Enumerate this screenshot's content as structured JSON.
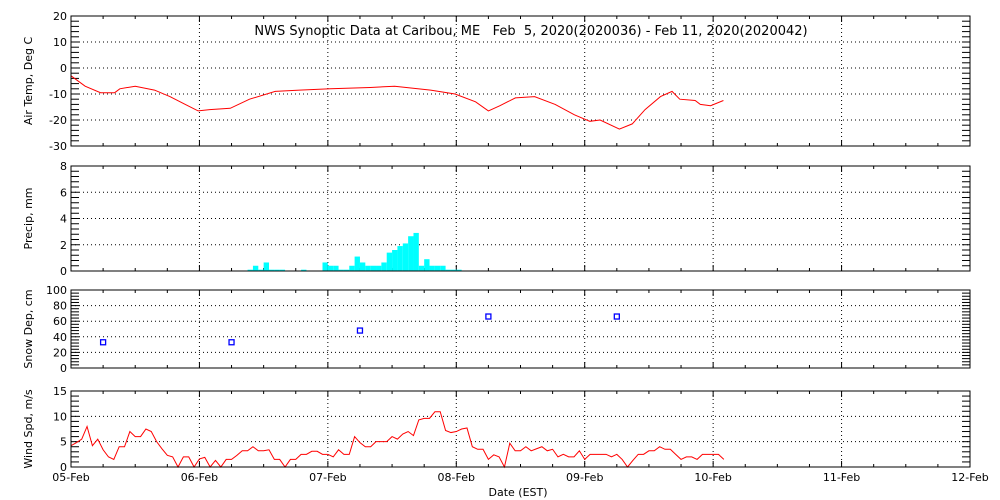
{
  "chart_data": {
    "type": "line",
    "title": "NWS Synoptic Data at Caribou, ME   Feb  5, 2020(2020036) - Feb 11, 2020(2020042)",
    "xlabel": "Date (EST)",
    "x_ticks": [
      "05-Feb",
      "06-Feb",
      "07-Feb",
      "08-Feb",
      "09-Feb",
      "10-Feb",
      "11-Feb",
      "12-Feb"
    ],
    "x_range_days": [
      0,
      7
    ],
    "grid": true,
    "panels": [
      {
        "name": "air-temp",
        "type": "line",
        "ylabel": "Air Temp, Deg C",
        "ylim": [
          -30,
          20
        ],
        "yticks": [
          -30,
          -20,
          -10,
          0,
          10,
          20
        ],
        "color": "#ff0000",
        "x_days": [
          0,
          0.11,
          0.23,
          0.34,
          0.38,
          0.5,
          0.65,
          0.77,
          0.89,
          0.99,
          1.08,
          1.24,
          1.39,
          1.59,
          1.78,
          2.02,
          2.33,
          2.52,
          2.8,
          2.99,
          3.15,
          3.25,
          3.34,
          3.46,
          3.61,
          3.77,
          3.92,
          4.04,
          4.12,
          4.27,
          4.37,
          4.47,
          4.59,
          4.68,
          4.74,
          4.86,
          4.9,
          4.98,
          5.08
        ],
        "values": [
          -3,
          -7,
          -9.5,
          -9.5,
          -8,
          -7,
          -8.5,
          -11,
          -14,
          -16.5,
          -16,
          -15.5,
          -12,
          -9,
          -8.5,
          -8,
          -7.5,
          -7,
          -8.5,
          -10,
          -13,
          -16.5,
          -14.5,
          -11.5,
          -11,
          -14,
          -18,
          -20.5,
          -20,
          -23.5,
          -21.5,
          -16,
          -11,
          -9,
          -12,
          -12.5,
          -14,
          -14.5,
          -12.5
        ]
      },
      {
        "name": "precip",
        "type": "bar",
        "ylabel": "Precip, mm",
        "ylim": [
          0,
          8
        ],
        "yticks": [
          0,
          2,
          4,
          6,
          8
        ],
        "color": "#00ffff",
        "start_hour": 33,
        "bin_hours": 1,
        "values": [
          0.1,
          0.4,
          0.1,
          0.65,
          0.1,
          0.1,
          0.1,
          0,
          0,
          0,
          0.1,
          0,
          0,
          0,
          0.65,
          0.4,
          0.4,
          0.1,
          0.1,
          0.4,
          1.1,
          0.65,
          0.4,
          0.4,
          0.4,
          0.65,
          1.4,
          1.6,
          1.9,
          2.1,
          2.65,
          2.9,
          0.4,
          0.9,
          0.4,
          0.4,
          0.4,
          0.1,
          0.1,
          0.1
        ]
      },
      {
        "name": "snow-depth",
        "type": "scatter",
        "ylabel": "Snow Dep, cm",
        "ylim": [
          0,
          100
        ],
        "yticks": [
          0,
          20,
          40,
          60,
          80,
          100
        ],
        "color": "#0000ff",
        "x_days": [
          0.25,
          1.25,
          2.25,
          3.25,
          4.25
        ],
        "values": [
          33,
          33,
          48,
          66,
          66
        ]
      },
      {
        "name": "wind-speed",
        "type": "line",
        "ylabel": "Wind Spd, m/s",
        "ylim": [
          0,
          15
        ],
        "yticks": [
          0,
          5,
          10,
          15
        ],
        "color": "#ff0000",
        "start_hour": 0,
        "step_hours": 1,
        "values": [
          4.2,
          4.8,
          5.5,
          8,
          4.2,
          5.5,
          3.4,
          2,
          1.5,
          4,
          4,
          7,
          6,
          6,
          7.5,
          7,
          5,
          3.6,
          2.3,
          2,
          0,
          2,
          2,
          0,
          1.6,
          1.9,
          0,
          1.3,
          0,
          1.5,
          1.5,
          2.3,
          3.2,
          3.2,
          4,
          3.2,
          3.2,
          3.4,
          1.5,
          1.5,
          0,
          1.5,
          1.5,
          2.5,
          2.5,
          3.1,
          3.1,
          2.5,
          2.5,
          2,
          3.4,
          2.5,
          2.5,
          6,
          4.8,
          4,
          4,
          5,
          5,
          5,
          6,
          5.5,
          6.5,
          7,
          6.2,
          9.3,
          9.6,
          9.6,
          10.9,
          10.9,
          7.2,
          6.8,
          7,
          7.5,
          7.7,
          4,
          3.5,
          3.5,
          1.5,
          2.4,
          2,
          0,
          4.7,
          3.2,
          3.2,
          4,
          3.2,
          3.6,
          4,
          3.2,
          3.5,
          2,
          2.5,
          2,
          2,
          3.2,
          1.5,
          2.5,
          2.5,
          2.5,
          2.5,
          2,
          2.5,
          1.5,
          0,
          1.3,
          2.5,
          2.5,
          3.2,
          3.2,
          4,
          3.5,
          3.5,
          2.5,
          1.5,
          2,
          2,
          1.5,
          2.5,
          2.5,
          2.5,
          2.5,
          1.5
        ]
      }
    ]
  }
}
